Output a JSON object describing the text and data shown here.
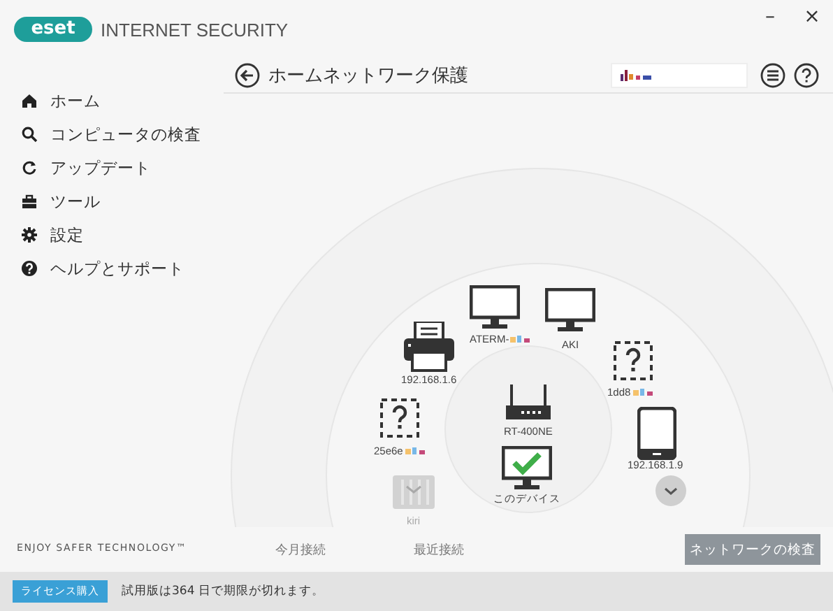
{
  "window": {
    "controls": [
      "–",
      "×"
    ]
  },
  "brand": {
    "logo": "eset",
    "product": "INTERNET SECURITY"
  },
  "sidebar": {
    "items": [
      {
        "kind": "home",
        "label": "ホーム"
      },
      {
        "kind": "search",
        "label": "コンピュータの検査"
      },
      {
        "kind": "update",
        "label": "アップデート"
      },
      {
        "kind": "tools",
        "label": "ツール"
      },
      {
        "kind": "settings",
        "label": "設定"
      },
      {
        "kind": "help",
        "label": "ヘルプとサポート"
      }
    ],
    "tagline": "ENJOY SAFER TECHNOLOGY™"
  },
  "header": {
    "title": "ホームネットワーク保護"
  },
  "network": {
    "devices": [
      {
        "kind": "printer",
        "label": "192.168.1.6",
        "dimmed": false
      },
      {
        "kind": "monitor",
        "label": "ATERM-",
        "dimmed": false
      },
      {
        "kind": "monitor",
        "label": "AKI",
        "dimmed": false
      },
      {
        "kind": "unknown",
        "label": "1dd8",
        "dimmed": false
      },
      {
        "kind": "unknown",
        "label": "25e6e",
        "dimmed": false
      },
      {
        "kind": "router",
        "label": "RT-400NE",
        "dimmed": false
      },
      {
        "kind": "tablet",
        "label": "192.168.1.9",
        "dimmed": false
      },
      {
        "kind": "this",
        "label": "このデバイス",
        "dimmed": false
      },
      {
        "kind": "nas",
        "label": "kiri",
        "dimmed": true
      }
    ],
    "filters": [
      "今月接続",
      "最近接続"
    ],
    "scan_button": "ネットワークの検査"
  },
  "status_bar": {
    "license_button": "ライセンス購入",
    "message": "試用版は364 日で期限が切れます。"
  }
}
